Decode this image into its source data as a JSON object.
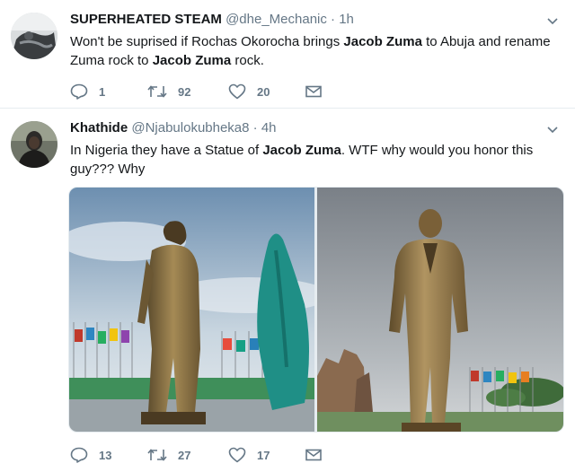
{
  "tweets": [
    {
      "name": "SUPERHEATED STEAM",
      "handle": "@dhe_Mechanic",
      "dot": "·",
      "time": "1h",
      "text_segments": [
        {
          "t": "Won't be suprised if Rochas Okorocha brings ",
          "bold": false
        },
        {
          "t": "Jacob Zuma",
          "bold": true
        },
        {
          "t": " to Abuja and rename Zuma rock to ",
          "bold": false
        },
        {
          "t": "Jacob Zuma",
          "bold": true
        },
        {
          "t": " rock.",
          "bold": false
        }
      ],
      "replies": "1",
      "retweets": "92",
      "likes": "20"
    },
    {
      "name": "Khathide",
      "handle": "@Njabulokubheka8",
      "dot": "·",
      "time": "4h",
      "text_segments": [
        {
          "t": "In Nigeria they have a Statue of ",
          "bold": false
        },
        {
          "t": "Jacob Zuma",
          "bold": true
        },
        {
          "t": ". WTF why would you honor this guy??? Why",
          "bold": false
        }
      ],
      "replies": "13",
      "retweets": "27",
      "likes": "17"
    }
  ],
  "icons": {
    "caret": "chevron-down-icon",
    "reply": "reply-icon",
    "retweet": "retweet-icon",
    "like": "heart-icon",
    "dm": "envelope-icon"
  },
  "colors": {
    "text": "#14171a",
    "secondary": "#657786",
    "border": "#e6ecf0"
  }
}
